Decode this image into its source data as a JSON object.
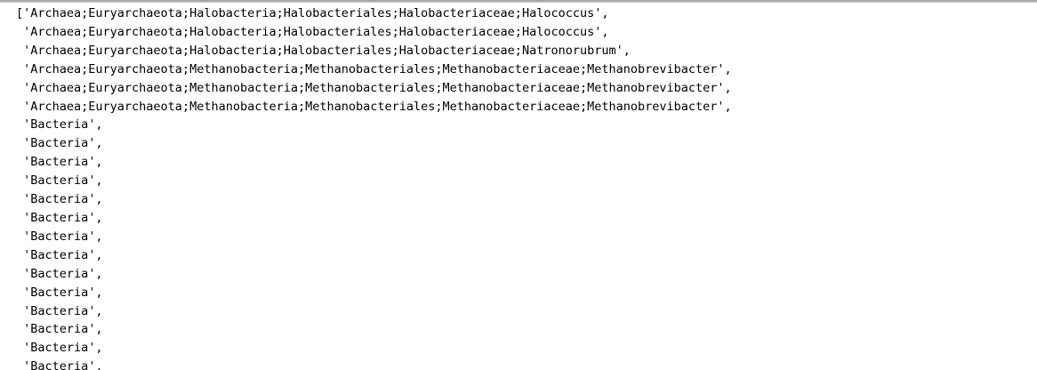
{
  "output": {
    "lines": [
      "['Archaea;Euryarchaeota;Halobacteria;Halobacteriales;Halobacteriaceae;Halococcus',",
      " 'Archaea;Euryarchaeota;Halobacteria;Halobacteriales;Halobacteriaceae;Halococcus',",
      " 'Archaea;Euryarchaeota;Halobacteria;Halobacteriales;Halobacteriaceae;Natronorubrum',",
      " 'Archaea;Euryarchaeota;Methanobacteria;Methanobacteriales;Methanobacteriaceae;Methanobrevibacter',",
      " 'Archaea;Euryarchaeota;Methanobacteria;Methanobacteriales;Methanobacteriaceae;Methanobrevibacter',",
      " 'Archaea;Euryarchaeota;Methanobacteria;Methanobacteriales;Methanobacteriaceae;Methanobrevibacter',",
      " 'Bacteria',",
      " 'Bacteria',",
      " 'Bacteria',",
      " 'Bacteria',",
      " 'Bacteria',",
      " 'Bacteria',",
      " 'Bacteria',",
      " 'Bacteria',",
      " 'Bacteria',",
      " 'Bacteria',",
      " 'Bacteria',",
      " 'Bacteria',",
      " 'Bacteria',",
      " 'Bacteria',"
    ]
  }
}
